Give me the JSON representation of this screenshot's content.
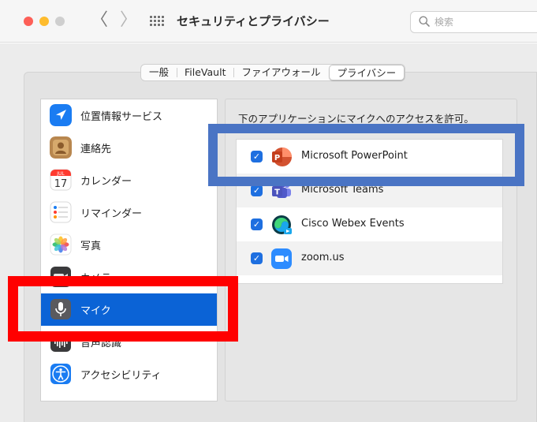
{
  "window": {
    "title": "セキュリティとプライバシー",
    "back": "〈",
    "forward": "〉"
  },
  "search": {
    "placeholder": "検索"
  },
  "tabs": [
    {
      "label": "一般"
    },
    {
      "label": "FileVault"
    },
    {
      "label": "ファイアウォール"
    },
    {
      "label": "プライバシー",
      "selected": true
    }
  ],
  "sidebar": {
    "items": [
      {
        "label": "位置情報サービス",
        "icon": "location-arrow-icon"
      },
      {
        "label": "連絡先",
        "icon": "contacts-icon"
      },
      {
        "label": "カレンダー",
        "icon": "calendar-icon",
        "icon_month": "JUL",
        "icon_day": "17"
      },
      {
        "label": "リマインダー",
        "icon": "reminders-icon"
      },
      {
        "label": "写真",
        "icon": "photos-icon"
      },
      {
        "label": "カメラ",
        "icon": "camera-icon"
      },
      {
        "label": "マイク",
        "icon": "microphone-icon",
        "selected": true
      },
      {
        "label": "音声認識",
        "icon": "speech-recognition-icon"
      },
      {
        "label": "アクセシビリティ",
        "icon": "accessibility-icon"
      }
    ]
  },
  "main": {
    "description": "下のアプリケーションにマイクへのアクセスを許可。",
    "apps": [
      {
        "name": "Microsoft PowerPoint",
        "checked": true,
        "icon": "powerpoint-icon"
      },
      {
        "name": "Microsoft Teams",
        "checked": true,
        "icon": "teams-icon"
      },
      {
        "name": "Cisco Webex Events",
        "checked": true,
        "icon": "webex-icon"
      },
      {
        "name": "zoom.us",
        "checked": true,
        "icon": "zoom-icon"
      }
    ]
  },
  "colors": {
    "selection": "#0b63d6",
    "checkbox": "#1e6fe0",
    "highlight_blue": "#4a74c4",
    "highlight_red": "#ff0000"
  }
}
